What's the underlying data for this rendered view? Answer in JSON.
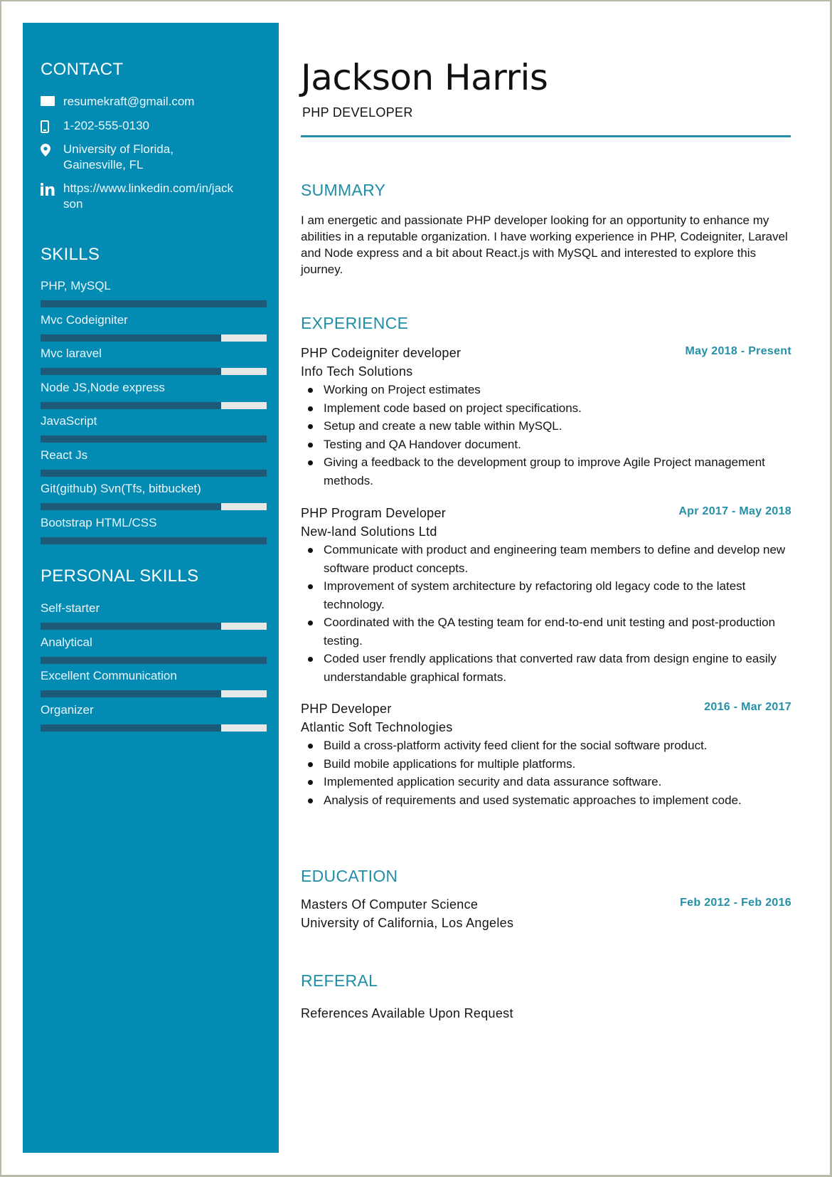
{
  "colors": {
    "sidebar": "#038bb4",
    "skill_bar_fill": "#1d5a78",
    "skill_bar_track": "#e7e8e8",
    "accent": "#1f8ea6",
    "page_border": "#b9baa8"
  },
  "header": {
    "name": "Jackson Harris",
    "title": "PHP DEVELOPER"
  },
  "sidebar": {
    "contact": {
      "heading": "CONTACT",
      "items": [
        {
          "icon": "envelope-icon",
          "text": "resumekraft@gmail.com"
        },
        {
          "icon": "mobile-phone-icon",
          "text": "1-202-555-0130"
        },
        {
          "icon": "map-pin-icon",
          "text": "University of Florida, Gainesville, FL"
        },
        {
          "icon": "linkedin-icon",
          "text": "https://www.linkedin.com/in/jackson"
        }
      ]
    },
    "skills": {
      "heading": "SKILLS",
      "items": [
        {
          "label": "PHP, MySQL",
          "level_percent": 100
        },
        {
          "label": "Mvc Codeigniter",
          "level_percent": 80
        },
        {
          "label": "Mvc laravel",
          "level_percent": 80
        },
        {
          "label": "Node JS,Node express",
          "level_percent": 80
        },
        {
          "label": "JavaScript",
          "level_percent": 100
        },
        {
          "label": "React Js",
          "level_percent": 100
        },
        {
          "label": "Git(github) Svn(Tfs, bitbucket)",
          "level_percent": 80
        },
        {
          "label": "Bootstrap HTML/CSS",
          "level_percent": 100
        }
      ]
    },
    "personal_skills": {
      "heading": "PERSONAL SKILLS",
      "items": [
        {
          "label": "Self-starter",
          "level_percent": 80
        },
        {
          "label": "Analytical",
          "level_percent": 100
        },
        {
          "label": "Excellent Communication",
          "level_percent": 80
        },
        {
          "label": "Organizer",
          "level_percent": 80
        }
      ]
    }
  },
  "summary": {
    "heading": "SUMMARY",
    "text": "I am energetic and passionate PHP developer looking for an opportunity to enhance my abilities in a reputable organization. I have working experience in PHP, Codeigniter, Laravel and Node express and a bit about React.js with MySQL and interested to explore this journey."
  },
  "experience": {
    "heading": "EXPERIENCE",
    "jobs": [
      {
        "title": "PHP Codeigniter developer",
        "company": "Info Tech Solutions",
        "dates": "May 2018 - Present",
        "bullets": [
          "Working on Project estimates",
          "Implement code based on project specifications.",
          "Setup and create a new table within MySQL.",
          "Testing and QA Handover document.",
          "Giving a feedback to the development group to improve Agile Project management methods."
        ]
      },
      {
        "title": "PHP Program Developer",
        "company": "New-land Solutions Ltd",
        "dates": "Apr 2017 - May 2018",
        "bullets": [
          "Communicate with product and engineering team members to define and develop new software product concepts.",
          "Improvement of system architecture by refactoring old legacy code to the latest technology.",
          "Coordinated with the QA testing team for end-to-end unit testing and post-production testing.",
          "Coded user frendly applications that converted raw data from design engine to easily understandable graphical formats."
        ]
      },
      {
        "title": "PHP Developer",
        "company": "Atlantic Soft Technologies",
        "dates": "2016 - Mar 2017",
        "bullets": [
          "Build a cross-platform activity feed client for the social software product.",
          "Build mobile applications for multiple platforms.",
          "Implemented application security and data assurance software.",
          "Analysis of requirements and used systematic approaches to implement code."
        ]
      }
    ]
  },
  "education": {
    "heading": "EDUCATION",
    "degree": "Masters Of Computer Science",
    "school": "University of California, Los Angeles",
    "dates": "Feb 2012 - Feb 2016"
  },
  "referral": {
    "heading": "REFERAL",
    "text": "References Available Upon Request"
  }
}
